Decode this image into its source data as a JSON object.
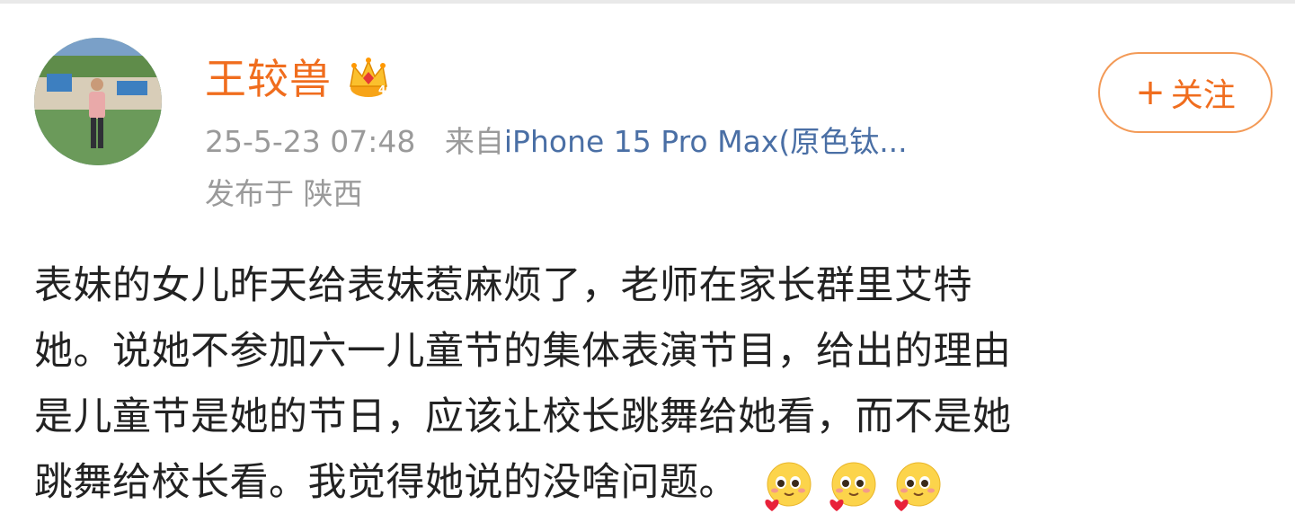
{
  "user": {
    "name": "王较兽",
    "badge_level": "4"
  },
  "meta": {
    "timestamp": "25-5-23 07:48",
    "from_prefix": "来自",
    "device": "iPhone 15 Pro Max(原色钛...",
    "location": "发布于 陕西"
  },
  "follow_button": {
    "plus": "+",
    "label": "关注"
  },
  "post": {
    "lines": [
      "表妹的女儿昨天给表妹惹麻烦了，老师在家长群里艾特",
      "她。说她不参加六一儿童节的集体表演节目，给出的理由",
      "是儿童节是她的节日，应该让校长跳舞给她看，而不是她",
      "跳舞给校长看。我觉得她说的没啥问题。"
    ],
    "emojis": [
      "heart-love-emoji",
      "heart-love-emoji",
      "heart-love-emoji"
    ]
  },
  "colors": {
    "username": "#f06d1e",
    "meta_text": "#9a9a9a",
    "device_link": "#4a6fa5",
    "follow_border": "#f39a57"
  }
}
